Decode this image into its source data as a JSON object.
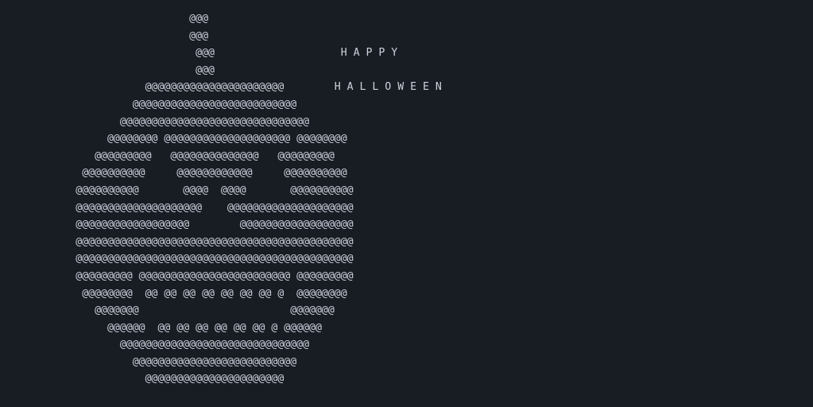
{
  "terminal": {
    "background": "#181c23",
    "foreground": "#cdd3de",
    "lines": [
      "                              @@@",
      "                              @@@",
      "                               @@@                    H A P P Y",
      "                               @@@",
      "                       @@@@@@@@@@@@@@@@@@@@@@        H A L L O W E E N",
      "                     @@@@@@@@@@@@@@@@@@@@@@@@@@",
      "                   @@@@@@@@@@@@@@@@@@@@@@@@@@@@@@",
      "                 @@@@@@@@ @@@@@@@@@@@@@@@@@@@@ @@@@@@@@",
      "               @@@@@@@@@   @@@@@@@@@@@@@@   @@@@@@@@@",
      "             @@@@@@@@@@     @@@@@@@@@@@@     @@@@@@@@@@",
      "            @@@@@@@@@@       @@@@  @@@@       @@@@@@@@@@",
      "            @@@@@@@@@@@@@@@@@@@@    @@@@@@@@@@@@@@@@@@@@",
      "            @@@@@@@@@@@@@@@@@@        @@@@@@@@@@@@@@@@@@",
      "            @@@@@@@@@@@@@@@@@@@@@@@@@@@@@@@@@@@@@@@@@@@@",
      "            @@@@@@@@@@@@@@@@@@@@@@@@@@@@@@@@@@@@@@@@@@@@",
      "            @@@@@@@@@ @@@@@@@@@@@@@@@@@@@@@@@@ @@@@@@@@@",
      "             @@@@@@@@  @@ @@ @@ @@ @@ @@ @@ @  @@@@@@@@",
      "               @@@@@@@                        @@@@@@@",
      "                 @@@@@@  @@ @@ @@ @@ @@ @@ @ @@@@@@",
      "                   @@@@@@@@@@@@@@@@@@@@@@@@@@@@@@",
      "                     @@@@@@@@@@@@@@@@@@@@@@@@@@",
      "                       @@@@@@@@@@@@@@@@@@@@@@"
    ]
  }
}
